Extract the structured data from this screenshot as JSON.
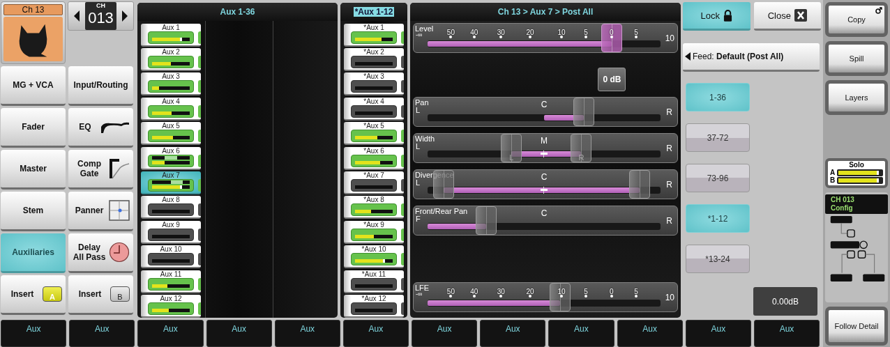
{
  "channel": {
    "name": "Ch 13",
    "number_label": "CH",
    "number": "013"
  },
  "nav_buttons": [
    {
      "label": "MG + VCA",
      "selected": false,
      "kind": "plain"
    },
    {
      "label": "Input/Routing",
      "selected": false,
      "kind": "plain"
    },
    {
      "label": "Fader",
      "selected": false,
      "kind": "plain"
    },
    {
      "label": "EQ",
      "selected": false,
      "kind": "eq"
    },
    {
      "label": "Master",
      "selected": false,
      "kind": "plain"
    },
    {
      "label": "Comp Gate",
      "selected": false,
      "kind": "comp"
    },
    {
      "label": "Stem",
      "selected": false,
      "kind": "plain"
    },
    {
      "label": "Panner",
      "selected": false,
      "kind": "panner"
    },
    {
      "label": "Auxiliaries",
      "selected": true,
      "kind": "plain"
    },
    {
      "label": "Delay All Pass",
      "selected": false,
      "kind": "delay"
    },
    {
      "label": "Insert",
      "selected": false,
      "kind": "insert",
      "badge": "A",
      "on": true
    },
    {
      "label": "Insert",
      "selected": false,
      "kind": "insert",
      "badge": "B",
      "on": false
    }
  ],
  "aux_main": {
    "title": "Aux 1-36",
    "title_highlighted": false,
    "strips": [
      {
        "label": "Aux 1",
        "selected": false,
        "active": true,
        "level": 0.8,
        "peak": true
      },
      {
        "label": "Aux 2",
        "selected": false,
        "active": true,
        "level": 0.5,
        "peak": false
      },
      {
        "label": "Aux 3",
        "selected": false,
        "active": true,
        "level": 0.18,
        "peak": false
      },
      {
        "label": "Aux 4",
        "selected": false,
        "active": true,
        "level": 0.52,
        "peak": false
      },
      {
        "label": "Aux 5",
        "selected": false,
        "active": true,
        "level": 0.56,
        "peak": false
      },
      {
        "label": "Aux 6",
        "selected": false,
        "active": true,
        "level": 0.33,
        "peak": false,
        "balance": {
          "level": 0.5
        }
      },
      {
        "label": "Aux 7",
        "selected": true,
        "active": true,
        "level": 0.8,
        "peak": true,
        "balance": {
          "level": 0.66
        }
      },
      {
        "label": "Aux 8",
        "selected": false,
        "active": false
      },
      {
        "label": "Aux 9",
        "selected": false,
        "active": false
      },
      {
        "label": "Aux 10",
        "selected": false,
        "active": false
      },
      {
        "label": "Aux 11",
        "selected": false,
        "active": true,
        "level": 0.4,
        "peak": false
      },
      {
        "label": "Aux 12",
        "selected": false,
        "active": true,
        "level": 0.44,
        "peak": false
      }
    ]
  },
  "aux_star": {
    "title": "*Aux 1-12",
    "title_highlighted": true,
    "strips": [
      {
        "label": "*Aux 1",
        "selected": false,
        "active": true,
        "level": 0.7,
        "peak": false
      },
      {
        "label": "*Aux 2",
        "selected": false,
        "active": false
      },
      {
        "label": "*Aux 3",
        "selected": false,
        "active": false
      },
      {
        "label": "*Aux 4",
        "selected": false,
        "active": false
      },
      {
        "label": "*Aux 5",
        "selected": false,
        "active": true,
        "level": 0.6,
        "peak": false
      },
      {
        "label": "*Aux 6",
        "selected": false,
        "active": true,
        "level": 0.66,
        "peak": false
      },
      {
        "label": "*Aux 7",
        "selected": false,
        "active": false
      },
      {
        "label": "*Aux 8",
        "selected": false,
        "active": true,
        "level": 0.43,
        "peak": false
      },
      {
        "label": "*Aux 9",
        "selected": false,
        "active": true,
        "level": 0.5,
        "peak": false
      },
      {
        "label": "*Aux 10",
        "selected": false,
        "active": true,
        "level": 0.8,
        "peak": true
      },
      {
        "label": "*Aux 11",
        "selected": false,
        "active": false
      },
      {
        "label": "*Aux 12",
        "selected": false,
        "active": false
      }
    ]
  },
  "send_panel": {
    "title": "Ch 13 > Aux 7 > Post All",
    "controls": [
      {
        "kind": "fader",
        "label": "Level",
        "min_label": "-∞",
        "ticks": [
          "50",
          "40",
          "30",
          "20",
          "10",
          "5",
          "0",
          "5"
        ],
        "max_label": "10",
        "level": 0.79,
        "highlighted": true,
        "readout": "0 dB"
      },
      {
        "kind": "pan",
        "label": "Pan",
        "left": "L",
        "center": "C",
        "right": "R",
        "level": 0.67
      },
      {
        "kind": "range",
        "label": "Width",
        "left": "L",
        "center": "M",
        "right": "R",
        "handles": [
          {
            "label": "L",
            "level": 0.36
          },
          {
            "label": "R",
            "level": 0.66
          }
        ]
      },
      {
        "kind": "range",
        "label": "Divergence",
        "left": "L",
        "center": "C",
        "right": "R",
        "handles": [
          {
            "level": 0.07
          },
          {
            "level": 0.91
          }
        ]
      },
      {
        "kind": "slide",
        "label": "Front/Rear Pan",
        "left": "F",
        "center": "C",
        "right": "R",
        "level": 0.25
      },
      {
        "kind": "fader",
        "label": "LFE",
        "min_label": "-∞",
        "ticks": [
          "50",
          "40",
          "30",
          "20",
          "10",
          "5",
          "0",
          "5"
        ],
        "max_label": "10",
        "level": 0.57,
        "highlighted": false
      }
    ]
  },
  "lock_button": {
    "label": "Lock",
    "selected": true
  },
  "close_button": {
    "label": "Close"
  },
  "feed_button": {
    "label": "Feed: **Default (Post All)**"
  },
  "banks": [
    {
      "label": "1-36",
      "selected": true
    },
    {
      "label": "37-72",
      "selected": false
    },
    {
      "label": "73-96",
      "selected": false
    },
    {
      "label": "*1-12",
      "selected": true
    },
    {
      "label": "*13-24",
      "selected": false
    }
  ],
  "readout": "0.00dB",
  "softkeys": [
    "Aux",
    "Aux",
    "Aux",
    "Aux",
    "Aux",
    "Aux",
    "Aux",
    "Aux",
    "Aux",
    "Aux",
    "Aux",
    "Aux"
  ],
  "side": {
    "buttons": [
      {
        "label": "Copy",
        "kind": "popout"
      },
      {
        "label": "Spill",
        "kind": "plain"
      },
      {
        "label": "Layers",
        "kind": "plain"
      }
    ],
    "solo": {
      "title": "Solo",
      "channels": [
        {
          "label": "A",
          "level": 0.88
        },
        {
          "label": "B",
          "level": 0.88
        }
      ]
    },
    "config": {
      "lines": [
        "CH 013",
        "Config"
      ]
    },
    "follow_button": {
      "label": "Follow Detail"
    }
  }
}
